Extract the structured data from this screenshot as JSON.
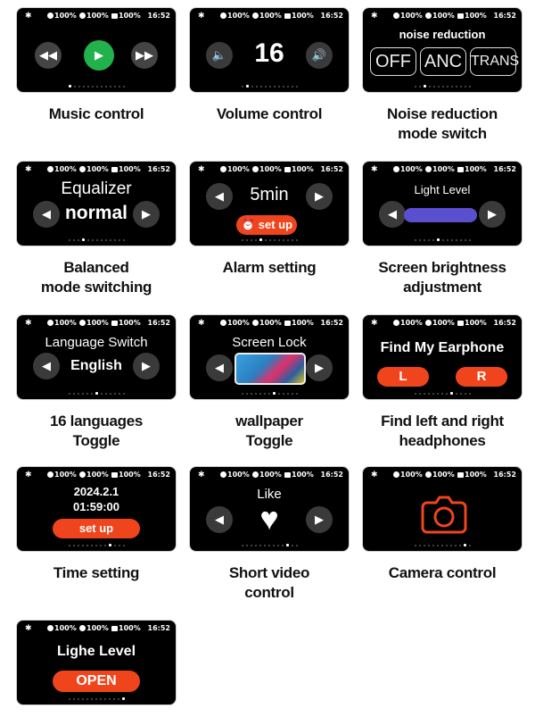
{
  "status": {
    "bluetooth": "✱",
    "earbud_left": "100%",
    "earbud_right": "100%",
    "case": "100%",
    "time": "16:52"
  },
  "cards": [
    {
      "label_line1": "Music control",
      "label_line2": "",
      "active_dot": 0
    },
    {
      "label_line1": "Volume control",
      "label_line2": "",
      "volume": "16",
      "active_dot": 1
    },
    {
      "label_line1": "Noise reduction",
      "label_line2": "mode switch",
      "title": "noise reduction",
      "modes": [
        "OFF",
        "ANC",
        "TRANS"
      ],
      "active_dot": 2
    },
    {
      "label_line1": "Balanced",
      "label_line2": "mode switching",
      "title": "Equalizer",
      "value": "normal",
      "active_dot": 3
    },
    {
      "label_line1": "Alarm setting",
      "label_line2": "",
      "value": "5min",
      "button": "set up",
      "active_dot": 4
    },
    {
      "label_line1": "Screen brightness",
      "label_line2": "adjustment",
      "title": "Light Level",
      "bar_color": "#5a4fcf",
      "active_dot": 5
    },
    {
      "label_line1": "16 languages",
      "label_line2": "Toggle",
      "title": "Language Switch",
      "value": "English",
      "active_dot": 6
    },
    {
      "label_line1": "wallpaper",
      "label_line2": "Toggle",
      "title": "Screen Lock",
      "active_dot": 7
    },
    {
      "label_line1": "Find left and right",
      "label_line2": "headphones",
      "title": "Find My Earphone",
      "left": "L",
      "right": "R",
      "active_dot": 8
    },
    {
      "label_line1": "Time setting",
      "label_line2": "",
      "date": "2024.2.1",
      "time": "01:59:00",
      "button": "set up",
      "active_dot": 9
    },
    {
      "label_line1": "Short video",
      "label_line2": "control",
      "title": "Like",
      "active_dot": 10
    },
    {
      "label_line1": "Camera control",
      "label_line2": "",
      "active_dot": 11
    },
    {
      "label_line1": "",
      "label_line2": "",
      "title": "Lighe Level",
      "button": "OPEN",
      "active_dot": 12
    }
  ],
  "accent": "#f0451c",
  "play_color": "#22b24c"
}
